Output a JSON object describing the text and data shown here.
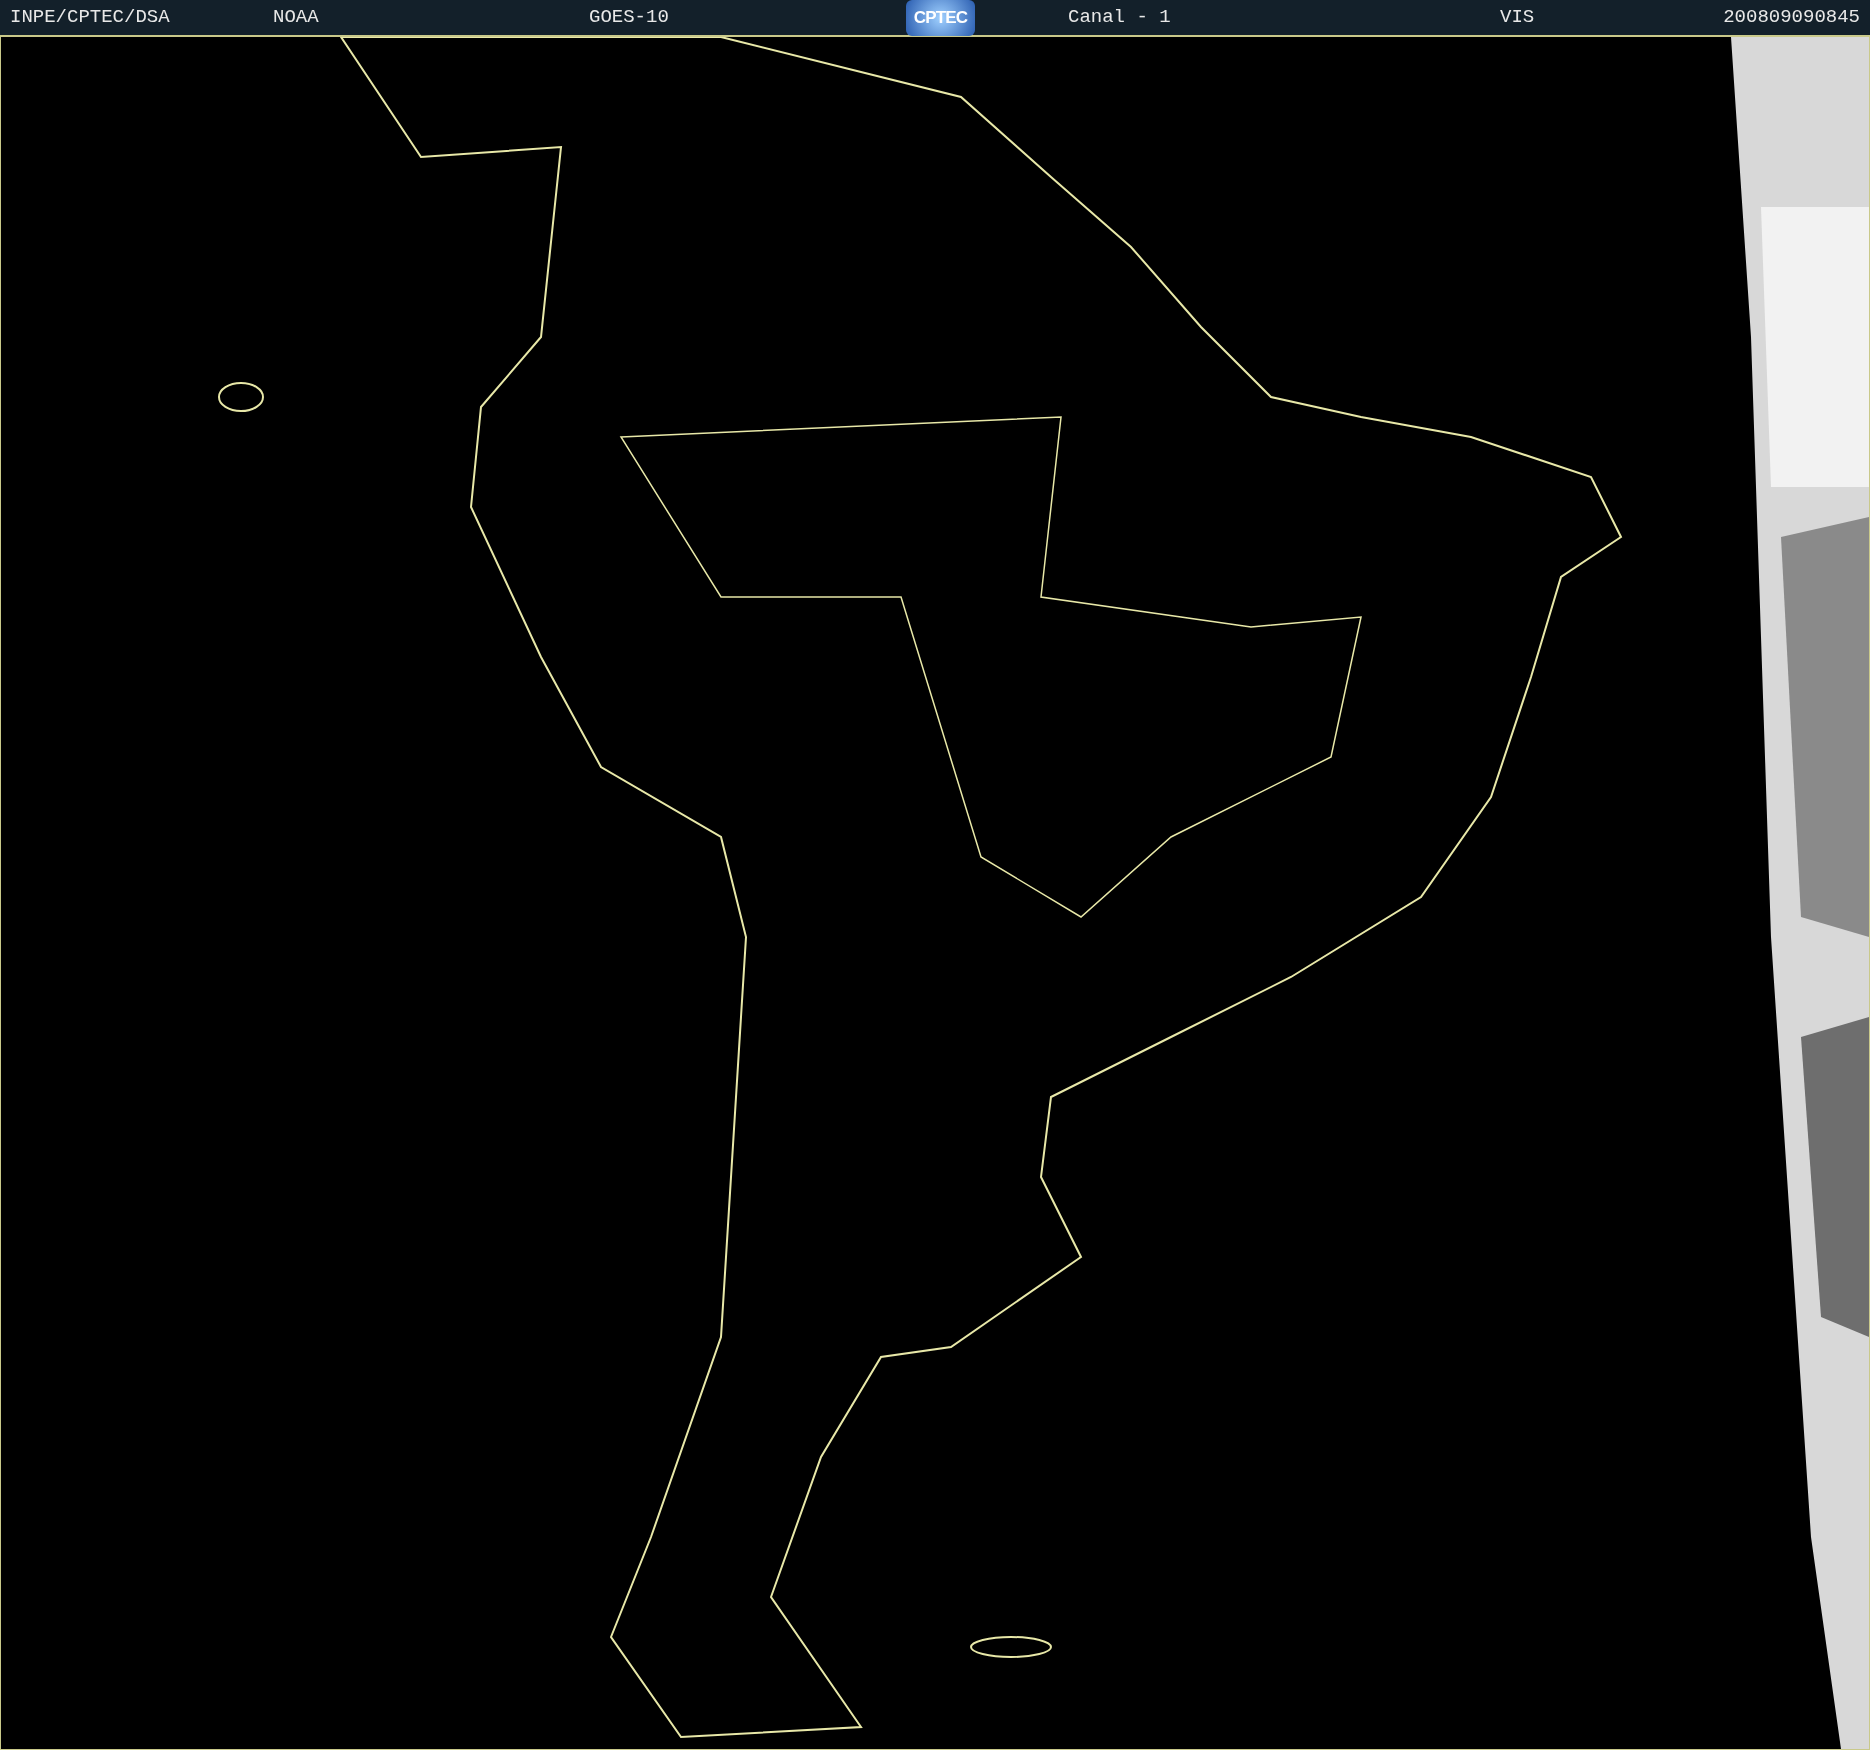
{
  "header": {
    "items": [
      {
        "kind": "text",
        "text": "INPE/CPTEC/DSA"
      },
      {
        "kind": "text",
        "text": "NOAA"
      },
      {
        "kind": "text",
        "text": "GOES-10"
      },
      {
        "kind": "logo",
        "text": "CPTEC"
      },
      {
        "kind": "text",
        "text": "Canal - 1"
      },
      {
        "kind": "text",
        "text": "VIS"
      },
      {
        "kind": "text",
        "text": "200809090845"
      }
    ]
  }
}
